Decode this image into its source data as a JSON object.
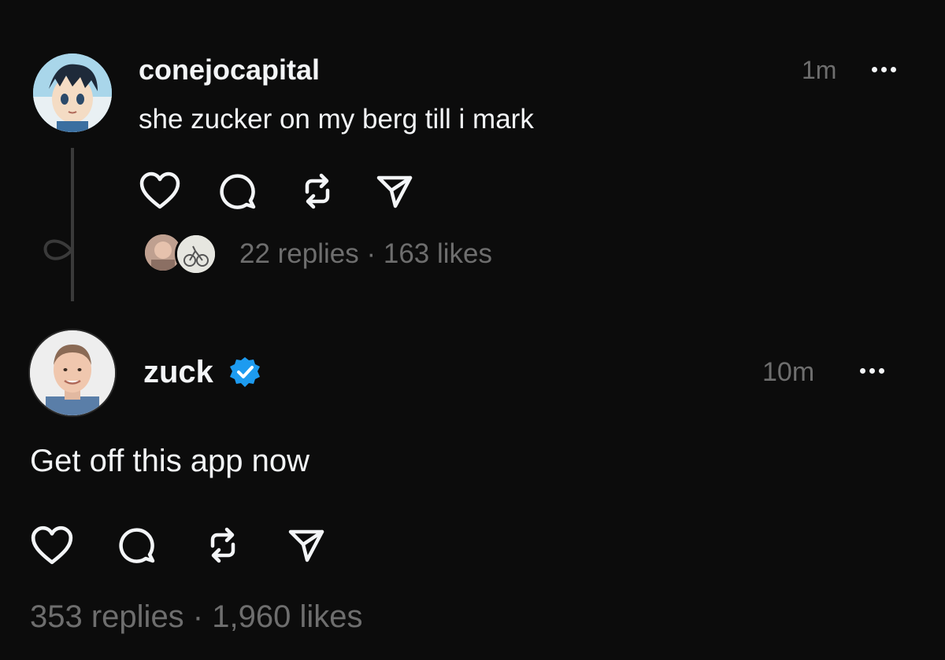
{
  "post1": {
    "username": "conejocapital",
    "time": "1m",
    "text": "she zucker on my berg till i mark",
    "stats": "22 replies · 163 likes",
    "avatar_icon": "anime-avatar"
  },
  "post2": {
    "username": "zuck",
    "verified": true,
    "time": "10m",
    "text": "Get off this app now",
    "stats": "353 replies · 1,960 likes",
    "avatar_icon": "person-avatar"
  },
  "colors": {
    "background": "#0c0c0c",
    "text": "#f3f5f7",
    "muted": "#6e6e6e",
    "verified": "#1d9bf0"
  }
}
